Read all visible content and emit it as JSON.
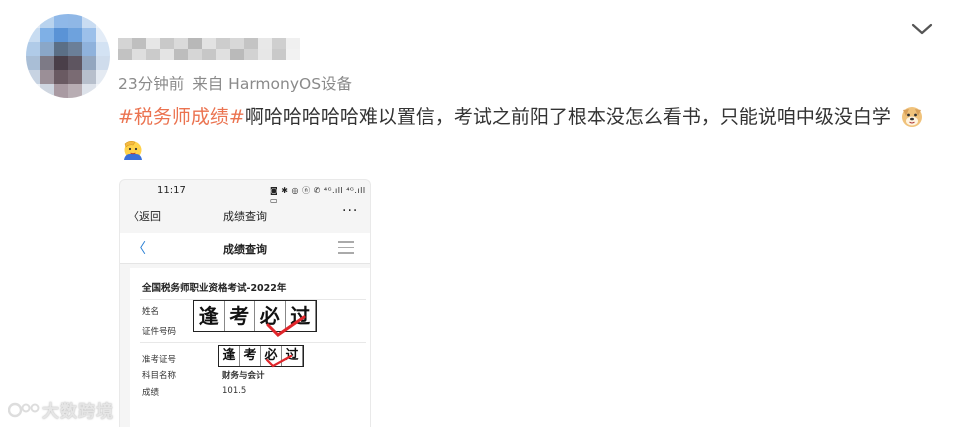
{
  "post": {
    "time": "23分钟前",
    "source": "来自 HarmonyOS设备",
    "hashtag": "#税务师成绩#",
    "text": "啊哈哈哈哈哈难以置信，考试之前阳了根本没怎么看书，只能说咱中级没白学",
    "emojis": [
      "doge-emoji",
      "salute-emoji"
    ]
  },
  "screenshot": {
    "status_time": "11:17",
    "status_icons": "◙ ✱ ◎ ⓝ ✆ ⁴ᴳ.ıll ⁴ᴳ.ıll ▭",
    "back_label": "〈返回",
    "nav_title": "成绩查询",
    "more_label": "···",
    "sub_back": "〈",
    "sub_title": "成绩查询",
    "heading": "全国税务师职业资格考试-2022年",
    "name_label": "姓名",
    "id_label": "证件号码",
    "ticket_label": "准考证号",
    "subject_label": "科目名称",
    "subject_value": "财务与会计",
    "score_label": "成绩",
    "score_value": "101.5",
    "stamp_chars": [
      "逢",
      "考",
      "必",
      "过"
    ]
  },
  "watermark": "大数跨境",
  "colors": {
    "hashtag": "#eb7350",
    "meta": "#8a8a8a",
    "link_blue": "#2a7fd4"
  }
}
